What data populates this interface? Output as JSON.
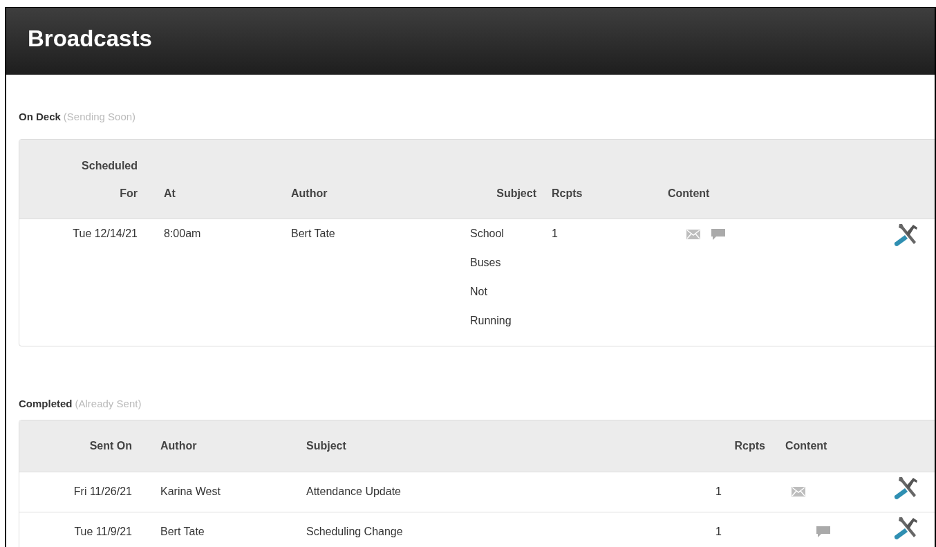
{
  "title": "Broadcasts",
  "sections": [
    {
      "label": "On Deck",
      "note": "(Sending Soon)",
      "kind": "scheduled",
      "columns": [
        "Scheduled For",
        "At",
        "Author",
        "Subject",
        "Rcpts",
        "Content"
      ],
      "rows": [
        {
          "cells": [
            "Tue 12/14/21",
            "8:00am",
            "Bert Tate",
            "School Buses Not Running",
            "1"
          ],
          "email": true,
          "sms": true
        }
      ]
    },
    {
      "label": "Completed",
      "note": "(Already Sent)",
      "kind": "completed",
      "columns": [
        "Sent On",
        "Author",
        "Subject",
        "Rcpts",
        "Content"
      ],
      "rows": [
        {
          "cells": [
            "Fri 11/26/21",
            "Karina West",
            "Attendance Update",
            "1"
          ],
          "email": true,
          "sms": false
        },
        {
          "cells": [
            "Tue 11/9/21",
            "Bert Tate",
            "Scheduling Change",
            "1"
          ],
          "email": false,
          "sms": true
        }
      ]
    }
  ]
}
